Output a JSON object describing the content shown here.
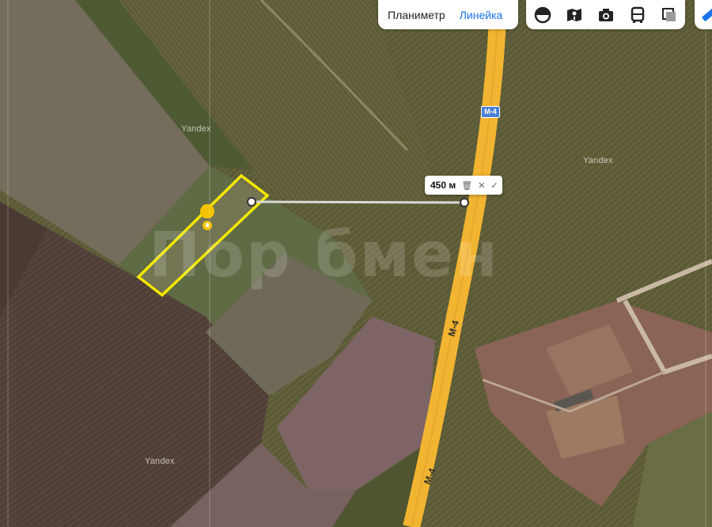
{
  "toolbar": {
    "planimeter_label": "Планиметр",
    "ruler_label": "Линейка",
    "active_mode": "Линейка",
    "accent_color": "#1a73e8",
    "layer_buttons": [
      "map-layers-icon",
      "panorama-icon",
      "photo-icon",
      "transit-icon",
      "traffic-icon"
    ],
    "extra_button": "ruler-icon"
  },
  "ruler": {
    "distance": "450 м",
    "actions": [
      "trash-icon",
      "close-icon",
      "check-icon"
    ]
  },
  "map": {
    "type": "satellite",
    "provider_labels": [
      "Yandex",
      "Yandex",
      "Yandex"
    ],
    "watermark": "Пор бмен",
    "highway_name": "М-4",
    "highway_shield": "М-4",
    "highway_color": "#f2b531",
    "plot_outline_color": "#f5e800",
    "marker_color": "#f5c400",
    "measure_line_color": "#d8d8d8"
  }
}
